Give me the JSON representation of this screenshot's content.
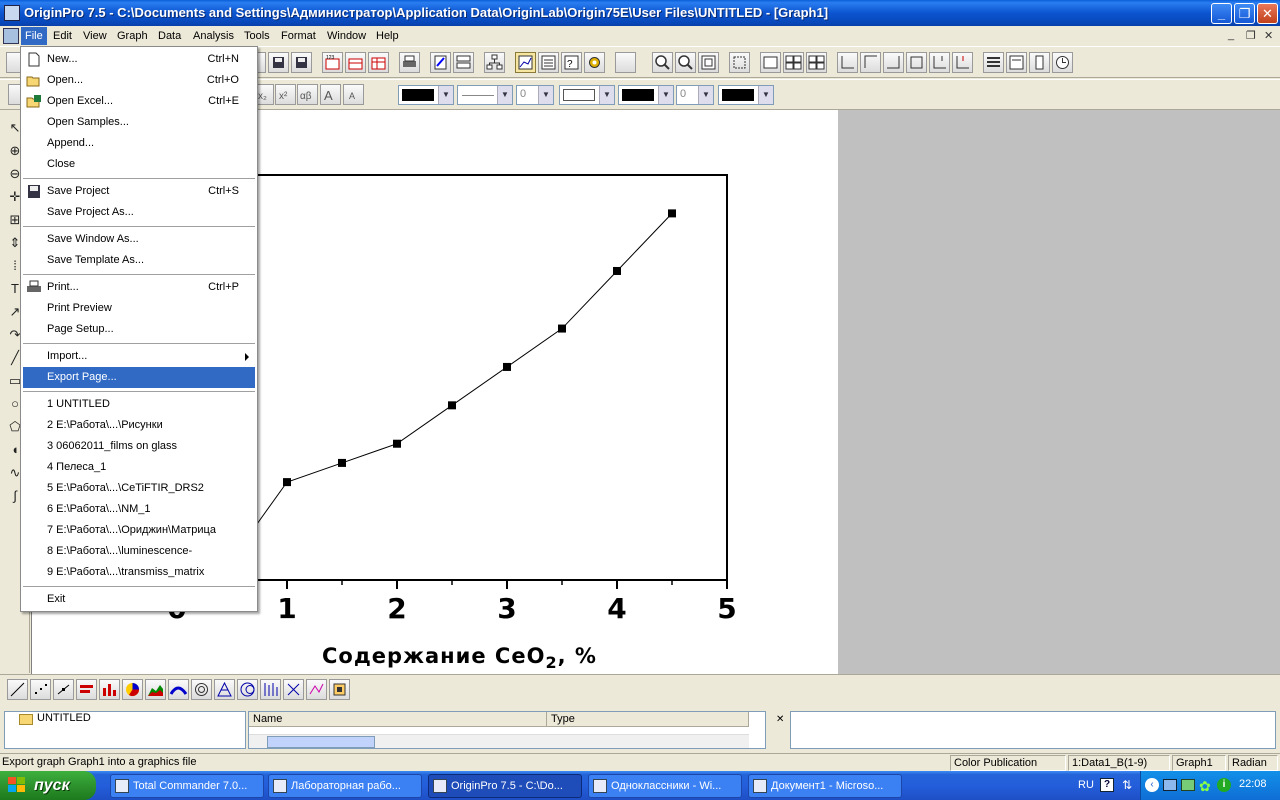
{
  "window": {
    "title": "OriginPro 7.5 - C:\\Documents and Settings\\Администратор\\Application Data\\OriginLab\\Origin75E\\User Files\\UNTITLED - [Graph1]",
    "minimize": "_",
    "maximize": "❐",
    "close": "✕"
  },
  "menubar": {
    "items": [
      "File",
      "Edit",
      "View",
      "Graph",
      "Data",
      "Analysis",
      "Tools",
      "Format",
      "Window",
      "Help"
    ],
    "mdi_controls": [
      "_",
      "❐",
      "✕"
    ]
  },
  "file_menu": {
    "items": [
      {
        "label": "New...",
        "shortcut": "Ctrl+N"
      },
      {
        "label": "Open...",
        "shortcut": "Ctrl+O"
      },
      {
        "label": "Open Excel...",
        "shortcut": "Ctrl+E"
      },
      {
        "label": "Open Samples...",
        "shortcut": ""
      },
      {
        "label": "Append...",
        "shortcut": ""
      },
      {
        "label": "Close",
        "shortcut": ""
      },
      {
        "label": "Save Project",
        "shortcut": "Ctrl+S"
      },
      {
        "label": "Save Project As...",
        "shortcut": ""
      },
      {
        "label": "Save Window As...",
        "shortcut": ""
      },
      {
        "label": "Save Template As...",
        "shortcut": ""
      },
      {
        "label": "Print...",
        "shortcut": "Ctrl+P"
      },
      {
        "label": "Print Preview",
        "shortcut": ""
      },
      {
        "label": "Page Setup...",
        "shortcut": ""
      },
      {
        "label": "Import...",
        "shortcut": ""
      },
      {
        "label": "Export Page...",
        "shortcut": ""
      },
      {
        "label": "1 UNTITLED",
        "shortcut": ""
      },
      {
        "label": "2 E:\\Работа\\...\\Рисунки",
        "shortcut": ""
      },
      {
        "label": "3 06062011_films on glass",
        "shortcut": ""
      },
      {
        "label": "4 Пелеса_1",
        "shortcut": ""
      },
      {
        "label": "5 E:\\Работа\\...\\CeTiFTIR_DRS2",
        "shortcut": ""
      },
      {
        "label": "6 E:\\Работа\\...\\NM_1",
        "shortcut": ""
      },
      {
        "label": "7 E:\\Работа\\...\\Ориджин\\Матрица",
        "shortcut": ""
      },
      {
        "label": "8 E:\\Работа\\...\\luminescence-",
        "shortcut": ""
      },
      {
        "label": "9 E:\\Работа\\...\\transmiss_matrix",
        "shortcut": ""
      },
      {
        "label": "Exit",
        "shortcut": ""
      }
    ]
  },
  "graph": {
    "x_tick_labels": [
      "0",
      "1",
      "2",
      "3",
      "4",
      "5"
    ],
    "xlabel_prefix": "Содержание CeO",
    "xlabel_sub": "2",
    "xlabel_suffix": ", %"
  },
  "chart_data": {
    "type": "line",
    "x": [
      0.5,
      1.0,
      1.5,
      2.0,
      2.5,
      3.0,
      3.5,
      4.0,
      4.5
    ],
    "y": [
      0.3,
      2.3,
      2.8,
      3.3,
      4.3,
      5.3,
      6.3,
      7.8,
      9.3
    ],
    "xlim": [
      0,
      5
    ],
    "ylim": [
      -0.25,
      10.3
    ],
    "xlabel": "Содержание CeO2, %",
    "x_ticks": [
      0,
      1,
      2,
      3,
      4,
      5
    ],
    "marker": "square",
    "line_color": "#000000"
  },
  "explorer": {
    "folder": "UNTITLED",
    "col_name": "Name",
    "col_type": "Type"
  },
  "statusbar": {
    "message": "Export graph Graph1 into a graphics file",
    "theme": "Color Publication",
    "dataset": "1:Data1_B(1-9)",
    "window": "Graph1",
    "angle": "Radian"
  },
  "taskbar": {
    "start": "пуск",
    "tasks": [
      "Total Commander 7.0...",
      "Лабораторная рабо...",
      "OriginPro 7.5 - C:\\Do...",
      "Одноклассники - Wi...",
      "Документ1 - Microso..."
    ],
    "lang": "RU",
    "time": "22:08"
  },
  "format_toolbar": {
    "num1": "0",
    "num2": "0"
  }
}
